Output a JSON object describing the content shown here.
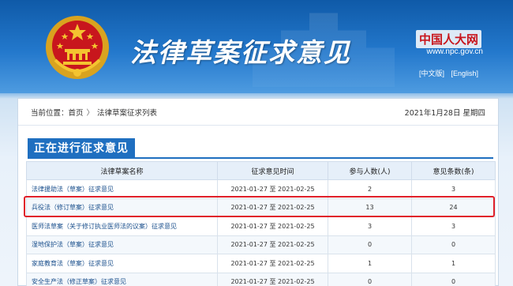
{
  "header": {
    "site_title": "法律草案征求意见",
    "npc_logo": "中国人大网",
    "npc_url": "www.npc.gov.cn",
    "lang_chinese": "[中文版]",
    "lang_english": "[English]"
  },
  "breadcrumb": {
    "label": "当前位置：",
    "home": "首页",
    "separator": "〉",
    "current": "法律草案征求列表",
    "date": "2021年1月28日  星期四"
  },
  "section_title": "正在进行征求意见",
  "table": {
    "headers": [
      "法律草案名称",
      "征求意见时间",
      "参与人数(人)",
      "意见条数(条)"
    ],
    "rows": [
      {
        "name": "法律援助法（草案）征求意见",
        "start": "2021-01-27",
        "to": "至",
        "end": "2021-02-25",
        "participants": "2",
        "opinions": "3"
      },
      {
        "name": "兵役法（修订草案）征求意见",
        "start": "2021-01-27",
        "to": "至",
        "end": "2021-02-25",
        "participants": "13",
        "opinions": "24"
      },
      {
        "name": "医师法草案（关于修订执业医师法的议案）征求意见",
        "start": "2021-01-27",
        "to": "至",
        "end": "2021-02-25",
        "participants": "3",
        "opinions": "3"
      },
      {
        "name": "湿地保护法（草案）征求意见",
        "start": "2021-01-27",
        "to": "至",
        "end": "2021-02-25",
        "participants": "0",
        "opinions": "0"
      },
      {
        "name": "家庭教育法（草案）征求意见",
        "start": "2021-01-27",
        "to": "至",
        "end": "2021-02-25",
        "participants": "1",
        "opinions": "1"
      },
      {
        "name": "安全生产法（修正草案）征求意见",
        "start": "2021-01-27",
        "to": "至",
        "end": "2021-02-25",
        "participants": "0",
        "opinions": "0"
      }
    ]
  },
  "colors": {
    "brand_blue": "#1f6fc0",
    "highlight_red": "#e0202a"
  }
}
